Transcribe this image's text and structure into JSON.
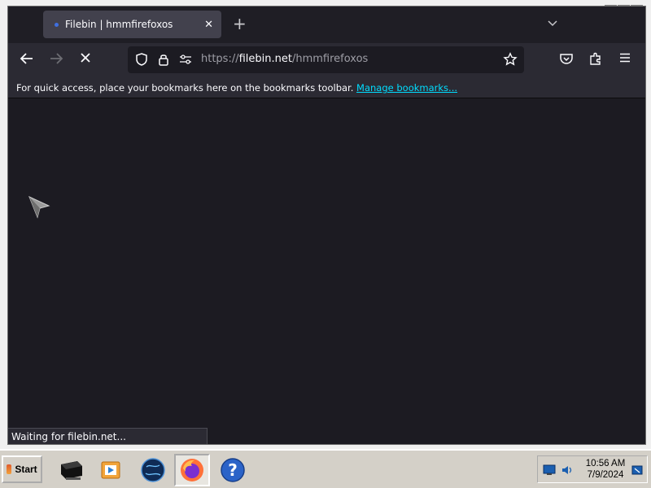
{
  "window": {
    "controls": [
      "_",
      "□",
      "✕"
    ]
  },
  "tabs": [
    {
      "title": "Filebin | hmmfirefoxos",
      "active": true
    }
  ],
  "navbar": {
    "url_scheme": "https://",
    "url_domain": "filebin.net",
    "url_path": "/hmmfirefoxos",
    "loading": true
  },
  "bookmarks": {
    "message": "For quick access, place your bookmarks here on the bookmarks toolbar.",
    "manage_link": "Manage bookmarks..."
  },
  "status": {
    "text": "Waiting for filebin.net..."
  },
  "taskbar": {
    "start_label": "Start",
    "apps": [
      {
        "icon": "computer-icon"
      },
      {
        "icon": "media-player-icon"
      },
      {
        "icon": "globe-icon"
      },
      {
        "icon": "firefox-icon",
        "active": true
      },
      {
        "icon": "help-icon"
      }
    ],
    "clock_time": "10:56 AM",
    "clock_date": "7/9/2024"
  },
  "colors": {
    "accent_link": "#00ddff",
    "content_bg": "#1c1b22",
    "toolbar_bg": "#2b2a33"
  }
}
